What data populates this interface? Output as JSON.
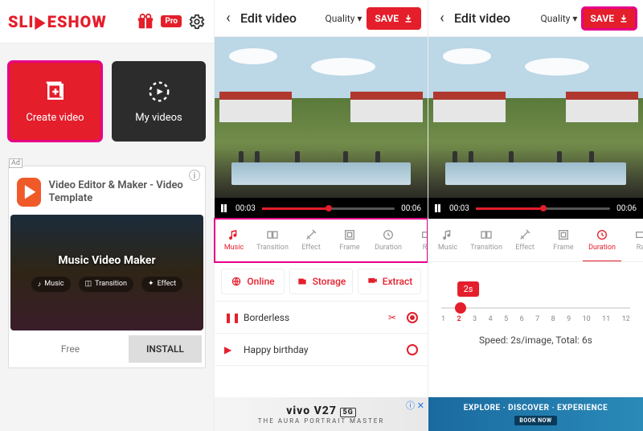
{
  "left": {
    "brand_a": "SLI",
    "brand_b": "ESHOW",
    "pro_label": "Pro",
    "create_label": "Create video",
    "myvideos_label": "My videos",
    "ad": {
      "tag": "Ad",
      "title": "Video Editor & Maker - Video Template",
      "banner_title": "Music Video Maker",
      "chip1": "Music",
      "chip2": "Transition",
      "chip3": "Effect",
      "free": "Free",
      "install": "INSTALL"
    }
  },
  "editor": {
    "title": "Edit video",
    "quality": "Quality",
    "save": "SAVE",
    "time_cur": "00:03",
    "time_tot": "00:06",
    "tabs": {
      "music": "Music",
      "transition": "Transition",
      "effect": "Effect",
      "frame": "Frame",
      "duration": "Duration",
      "ratio": "Ra"
    },
    "sources": {
      "online": "Online",
      "storage": "Storage",
      "extract": "Extract"
    },
    "tracks": [
      {
        "name": "Borderless",
        "playing": true,
        "selected": true
      },
      {
        "name": "Happy birthday",
        "playing": false,
        "selected": false
      }
    ],
    "duration": {
      "bubble": "2s",
      "ticks": [
        "1",
        "2",
        "3",
        "4",
        "5",
        "6",
        "7",
        "8",
        "9",
        "10",
        "11",
        "12"
      ],
      "current_index": 1,
      "summary": "Speed: 2s/image, Total: 6s"
    }
  },
  "ads": {
    "vivo_brand": "vivo V27",
    "vivo_tag": "5G",
    "vivo_sub": "THE AURA PORTRAIT MASTER",
    "travel_head": "EXPLORE · DISCOVER · EXPERIENCE",
    "travel_cta": "BOOK NOW"
  }
}
